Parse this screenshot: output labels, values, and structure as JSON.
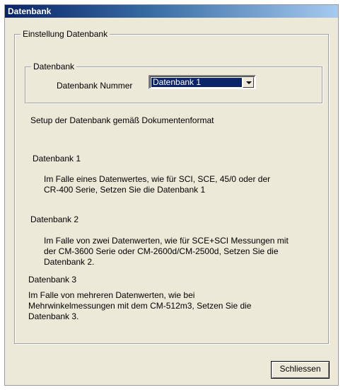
{
  "window": {
    "title": "Datenbank"
  },
  "settings_group": {
    "label": "Einstellung Datenbank"
  },
  "db_group": {
    "label": "Datenbank",
    "number_label": "Datenbank Nummer",
    "selected_value": "Datenbank 1"
  },
  "setup_text": "Setup der Datenbank gemäß Dokumentenformat",
  "descriptions": [
    {
      "heading": "Datenbank 1",
      "text": "Im Falle eines Datenwertes, wie für SCI, SCE, 45/0 oder der\nCR-400 Serie, Setzen Sie die Datenbank 1"
    },
    {
      "heading": "Datenbank 2",
      "text": "Im Falle von zwei Datenwerten, wie für SCE+SCI Messungen mit\nder CM-3600 Serie oder CM-2600d/CM-2500d, Setzen Sie die\nDatenbank 2."
    },
    {
      "heading": "Datenbank 3",
      "text": "Im Falle von mehreren Datenwerten, wie bei\nMehrwinkelmessungen mit dem CM-512m3, Setzen Sie die\nDatenbank 3."
    }
  ],
  "close_button": {
    "label": "Schliessen"
  }
}
